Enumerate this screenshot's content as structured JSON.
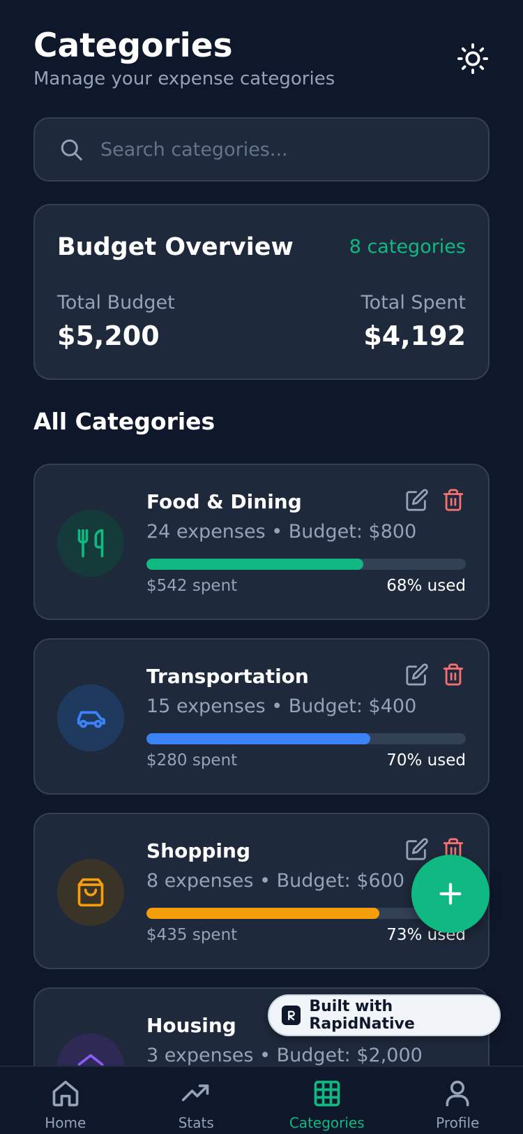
{
  "header": {
    "title": "Categories",
    "subtitle": "Manage your expense categories",
    "theme_icon": "sun-icon"
  },
  "search": {
    "placeholder": "Search categories...",
    "value": ""
  },
  "overview": {
    "title": "Budget Overview",
    "count": "8 categories",
    "total_budget_label": "Total Budget",
    "total_budget_value": "$5,200",
    "total_spent_label": "Total Spent",
    "total_spent_value": "$4,192"
  },
  "section_title": "All Categories",
  "categories": [
    {
      "name": "Food & Dining",
      "meta": "24 expenses • Budget: $800",
      "spent": "$542 spent",
      "used": "68% used",
      "progress": 0.68,
      "color": "#10b981",
      "icon_bg": "#153a3a",
      "icon": "utensils-icon"
    },
    {
      "name": "Transportation",
      "meta": "15 expenses • Budget: $400",
      "spent": "$280 spent",
      "used": "70% used",
      "progress": 0.7,
      "color": "#3b82f6",
      "icon_bg": "#1e3a5f",
      "icon": "car-icon"
    },
    {
      "name": "Shopping",
      "meta": "8 expenses • Budget: $600",
      "spent": "$435 spent",
      "used": "73% used",
      "progress": 0.73,
      "color": "#f59e0b",
      "icon_bg": "#3a3328",
      "icon": "shopping-bag-icon"
    },
    {
      "name": "Housing",
      "meta": "3 expenses • Budget: $2,000",
      "spent": "",
      "used": "",
      "progress": 0,
      "color": "#8b5cf6",
      "icon_bg": "#2e2a55",
      "icon": "home-icon"
    }
  ],
  "badge": {
    "text": "Built with RapidNative"
  },
  "tabs": [
    {
      "label": "Home",
      "icon": "home-icon",
      "active": false
    },
    {
      "label": "Stats",
      "icon": "trending-up-icon",
      "active": false
    },
    {
      "label": "Categories",
      "icon": "grid-icon",
      "active": true
    },
    {
      "label": "Profile",
      "icon": "user-icon",
      "active": false
    }
  ],
  "colors": {
    "background": "#0f172a",
    "card": "#1e293b",
    "accent": "#10b981",
    "delete": "#f87171"
  }
}
